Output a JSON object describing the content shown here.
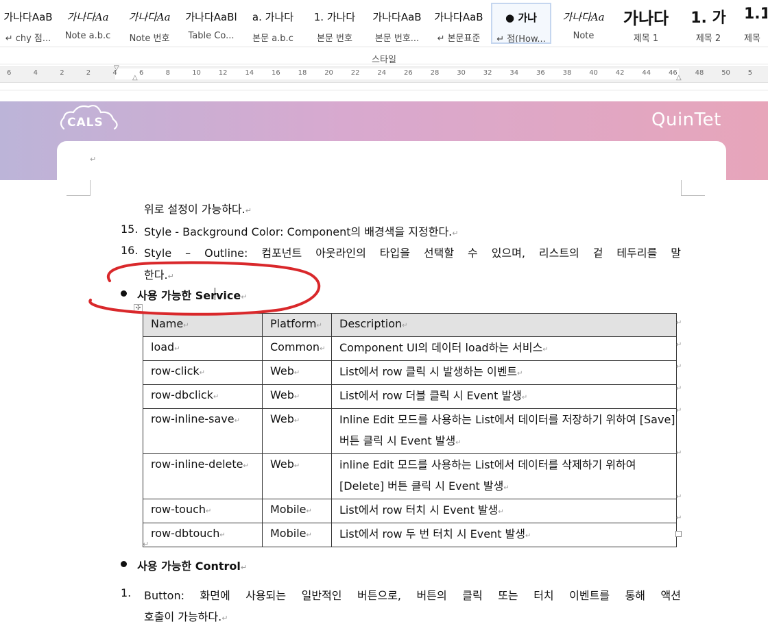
{
  "styles_gallery": {
    "tiles": [
      {
        "preview": "가나다AaB",
        "name": "↵ chy 점...",
        "kind": "plain"
      },
      {
        "preview": "가나다Aa",
        "name": "Note a.b.c",
        "kind": "italic"
      },
      {
        "preview": "가나다Aa",
        "name": "Note 번호",
        "kind": "italic"
      },
      {
        "preview": "가나다AaBl",
        "name": "Table Co...",
        "kind": "plain"
      },
      {
        "preview": "a.  가나다",
        "name": "본문 a.b.c",
        "kind": "plain"
      },
      {
        "preview": "1.  가나다",
        "name": "본문 번호",
        "kind": "plain"
      },
      {
        "preview": "가나다AaB",
        "name": "본문 번호...",
        "kind": "plain"
      },
      {
        "preview": "가나다AaB",
        "name": "↵ 본문표준",
        "kind": "plain"
      },
      {
        "preview": "●      가나",
        "name": "↵ 점(How...",
        "kind": "plain"
      },
      {
        "preview": "가나다Aa",
        "name": "Note",
        "kind": "italic"
      },
      {
        "preview": "가나다",
        "name": "제목 1",
        "kind": "big"
      },
      {
        "preview": "1.  가",
        "name": "제목 2",
        "kind": "bigr"
      },
      {
        "preview": "1.1",
        "name": "제목",
        "kind": "bigr"
      }
    ],
    "group_label": "스타일"
  },
  "ruler": {
    "ticks": [
      "6",
      "4",
      "2",
      "2",
      "4",
      "6",
      "8",
      "10",
      "12",
      "14",
      "16",
      "18",
      "20",
      "22",
      "24",
      "26",
      "28",
      "30",
      "32",
      "34",
      "36",
      "38",
      "40",
      "42",
      "44",
      "46",
      "48",
      "50",
      "5"
    ]
  },
  "header": {
    "left_logo": "CALS",
    "right_logo": "QuinTet",
    "colors": {
      "band_start": "#bcb4d8",
      "band_mid": "#d8a9cf",
      "band_end": "#e7a5ba"
    }
  },
  "document": {
    "pilcrow": "↵",
    "line_continuation": "위로 설정이 가능하다.",
    "item15": {
      "num": "15.",
      "text": "Style - Background Color: Component의 배경색을 지정한다."
    },
    "item16": {
      "num": "16.",
      "line1": "Style – Outline: 컴포넌트 아웃라인의 타입을 선택할 수 있으며, 리스트의 겉 테두리를 말",
      "line2": "한다."
    },
    "section_service": "사용 가능한 Service",
    "services_table": {
      "headers": [
        "Name",
        "Platform",
        "Description"
      ],
      "rows": [
        {
          "name": "load",
          "platform": "Common",
          "desc": "Component UI의 데이터 load하는 서비스"
        },
        {
          "name": "row-click",
          "platform": "Web",
          "desc": "List에서 row 클릭 시 발생하는 이벤트"
        },
        {
          "name": "row-dbclick",
          "platform": "Web",
          "desc": "List에서 row 더블 클릭 시 Event 발생"
        },
        {
          "name": "row-inline-save",
          "platform": "Web",
          "desc": "Inline Edit 모드를 사용하는 List에서 데이터를 저장하기 위하여 [Save] 버튼 클릭 시 Event 발생"
        },
        {
          "name": "row-inline-delete",
          "platform": "Web",
          "desc": "inline Edit 모드를 사용하는 List에서 데이터를 삭제하기 위하여 [Delete] 버튼 클릭 시 Event 발생"
        },
        {
          "name": "row-touch",
          "platform": "Mobile",
          "desc": "List에서 row 터치 시 Event 발생"
        },
        {
          "name": "row-dbtouch",
          "platform": "Mobile",
          "desc": "List에서 row 두 번 터치 시 Event 발생"
        }
      ]
    },
    "section_control": "사용 가능한 Control",
    "control_item1": {
      "num": "1.",
      "line1": "Button: 화면에 사용되는 일반적인 버튼으로, 버튼의 클릭 또는 터치 이벤트를 통해 액션",
      "line2": "호출이 가능하다."
    }
  },
  "annotation": {
    "color": "#d9282b",
    "shape": "freehand-ellipse"
  }
}
